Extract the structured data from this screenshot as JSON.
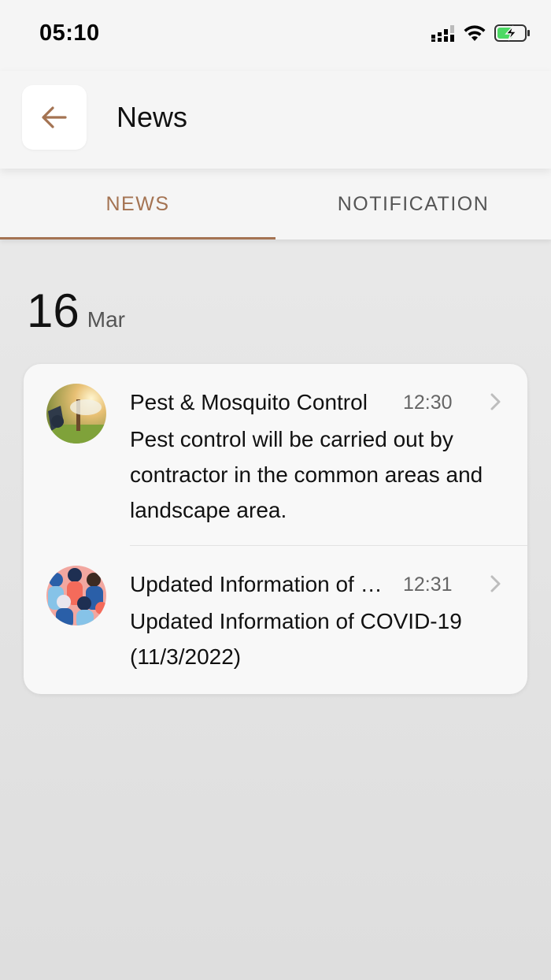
{
  "status_bar": {
    "time": "05:10",
    "icons": [
      "signal-icon",
      "wifi-icon",
      "battery-charging-icon"
    ],
    "battery_color": "#4cd964"
  },
  "header": {
    "title": "News",
    "back_icon": "arrow-left-icon",
    "accent_color": "#a47352"
  },
  "tabs": [
    {
      "label": "NEWS",
      "active": true
    },
    {
      "label": "NOTIFICATION",
      "active": false
    }
  ],
  "date_group": {
    "day": "16",
    "month": "Mar"
  },
  "news_items": [
    {
      "title": "Pest & Mosquito Control",
      "time": "12:30",
      "body": "Pest control will be carried out by contractor in the common areas and landscape area.",
      "thumbnail_icon": "pest-control-photo",
      "chevron_icon": "chevron-right-icon"
    },
    {
      "title": "Updated Information of COVID-19",
      "time": "12:31",
      "body": "Updated Information of COVID-19 (11/3/2022)",
      "thumbnail_icon": "crowd-illustration",
      "chevron_icon": "chevron-right-icon"
    }
  ]
}
